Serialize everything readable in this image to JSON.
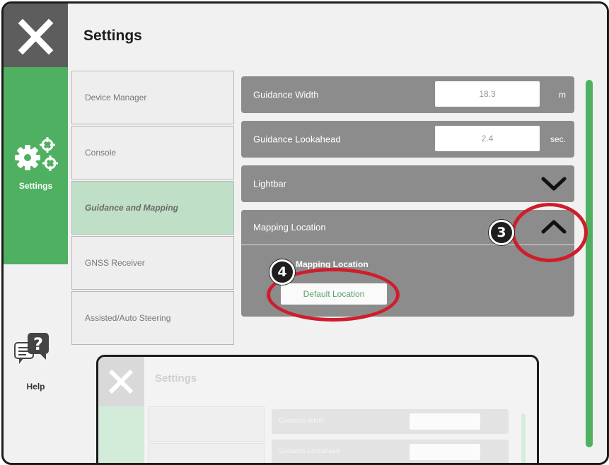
{
  "header": {
    "title": "Settings"
  },
  "rail": {
    "settings_label": "Settings",
    "help_label": "Help"
  },
  "categories": [
    {
      "label": "Device Manager"
    },
    {
      "label": "Console"
    },
    {
      "label": "Guidance and Mapping",
      "active": true
    },
    {
      "label": "GNSS Receiver"
    },
    {
      "label": "Assisted/Auto Steering"
    }
  ],
  "panel": {
    "guidance_width": {
      "label": "Guidance Width",
      "value": "18.3",
      "unit": "m"
    },
    "guidance_lookahead": {
      "label": "Guidance Lookahead",
      "value": "2.4",
      "unit": "sec."
    },
    "lightbar": {
      "label": "Lightbar"
    },
    "mapping_location": {
      "label": "Mapping Location",
      "sub_label": "Mapping Location",
      "default_button": "Default Location"
    }
  },
  "callouts": {
    "three": "3",
    "four": "4"
  },
  "mini": {
    "title": "Settings",
    "rows": [
      "Guidance Width",
      "Guidance Lookahead"
    ]
  },
  "colors": {
    "accent": "#4fb062",
    "annotation": "#cf1d2b",
    "row_bg": "#8c8c8c"
  }
}
